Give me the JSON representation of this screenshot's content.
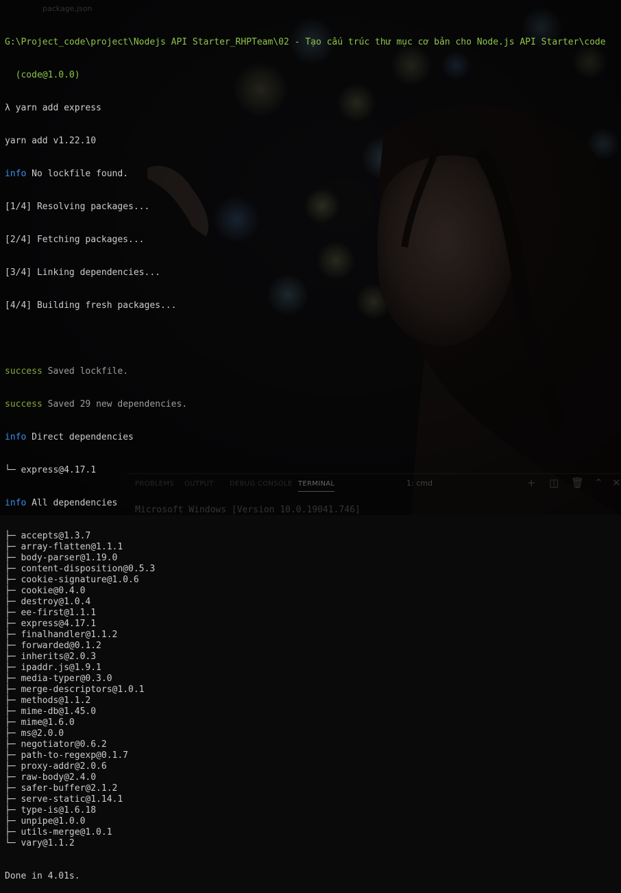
{
  "window": {
    "tab_hint": "package.json"
  },
  "terminal": {
    "cwd_path": "G:\\Project_code\\project\\Nodejs API Starter_RHPTeam\\02 - Tạo cấu trúc thư mục cơ bản cho Node.js API Starter\\code",
    "cwd_suffix": "  (code@1.0.0)",
    "prompt_symbol": "λ",
    "command": "yarn add express",
    "yarn_version": "yarn add v1.22.10",
    "info_label": "info",
    "success_label": "success",
    "no_lockfile": "No lockfile found.",
    "steps": [
      "[1/4] Resolving packages...",
      "[2/4] Fetching packages...",
      "[3/4] Linking dependencies...",
      "[4/4] Building fresh packages..."
    ],
    "saved_lockfile": "Saved lockfile.",
    "saved_deps": "Saved 29 new dependencies.",
    "direct_deps_label": "Direct dependencies",
    "direct_deps": [
      "└─ express@4.17.1"
    ],
    "all_deps_label": "All dependencies",
    "all_deps": [
      "├─ accepts@1.3.7",
      "├─ array-flatten@1.1.1",
      "├─ body-parser@1.19.0",
      "├─ content-disposition@0.5.3",
      "├─ cookie-signature@1.0.6",
      "├─ cookie@0.4.0",
      "├─ destroy@1.0.4",
      "├─ ee-first@1.1.1",
      "├─ express@4.17.1",
      "├─ finalhandler@1.1.2",
      "├─ forwarded@0.1.2",
      "├─ inherits@2.0.3",
      "├─ ipaddr.js@1.9.1",
      "├─ media-typer@0.3.0",
      "├─ merge-descriptors@1.0.1",
      "├─ methods@1.1.2",
      "├─ mime-db@1.45.0",
      "├─ mime@1.6.0",
      "├─ ms@2.0.0",
      "├─ negotiator@0.6.2",
      "├─ path-to-regexp@0.1.7",
      "├─ proxy-addr@2.0.6",
      "├─ raw-body@2.4.0",
      "├─ safer-buffer@2.1.2",
      "├─ serve-static@1.14.1",
      "├─ type-is@1.6.18",
      "├─ unpipe@1.0.0",
      "├─ utils-merge@1.0.1",
      "└─ vary@1.1.2"
    ],
    "done": "Done in 4.01s."
  },
  "panel": {
    "tabs": [
      "PROBLEMS",
      "OUTPUT",
      "DEBUG CONSOLE",
      "TERMINAL"
    ],
    "active_tab": "TERMINAL",
    "terminal_select": "1: cmd",
    "icons": [
      "plus-icon",
      "split-icon",
      "trash-icon",
      "chevron-up-icon",
      "close-icon"
    ],
    "windows_version": "Microsoft Windows [Version 10.0.19041.746]"
  },
  "colors": {
    "path": "#8ec44a",
    "info": "#3b8eea",
    "success": "#86a83a",
    "text": "#cccccc"
  }
}
